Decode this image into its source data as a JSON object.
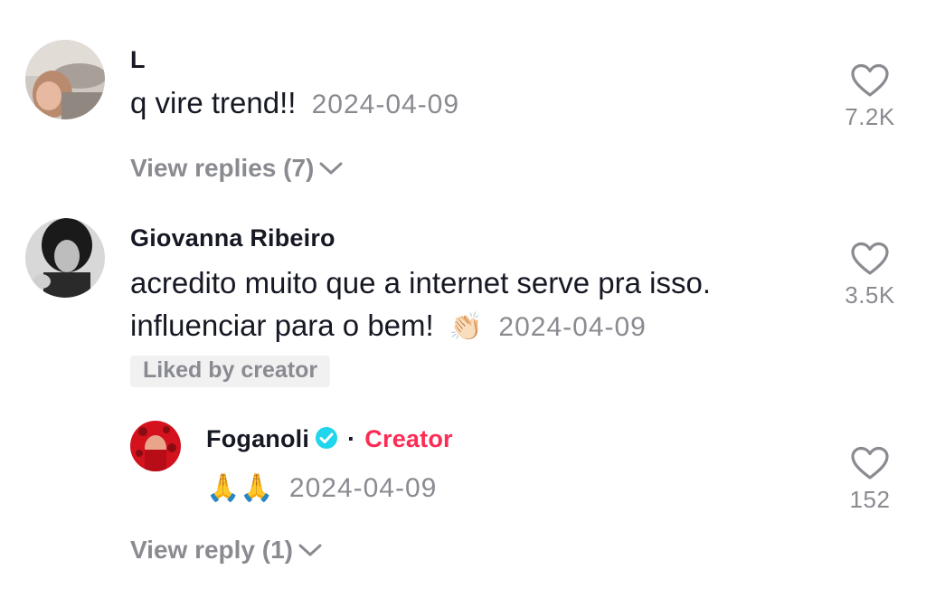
{
  "comments": [
    {
      "username": "L",
      "text": "q vire trend!!",
      "date": "2024-04-09",
      "likes": "7.2K",
      "view_replies": "View replies (7)"
    },
    {
      "username": "Giovanna Ribeiro",
      "text_line1": "acredito muito que a internet serve pra isso.",
      "text_line2": "influenciar para o bem!",
      "emoji": "👏🏻",
      "date": "2024-04-09",
      "likes": "3.5K",
      "badge": "Liked by creator",
      "reply": {
        "username": "Foganoli",
        "separator": "·",
        "creator_label": "Creator",
        "text": "🙏🙏",
        "date": "2024-04-09",
        "likes": "152"
      },
      "view_replies": "View reply (1)"
    }
  ],
  "colors": {
    "accent": "#fe2c55",
    "verified": "#20d5ec",
    "muted": "#8a8b91",
    "text": "#161823",
    "badge_bg": "#f1f1f2"
  },
  "icons": [
    "heart-outline-icon",
    "chevron-down-icon",
    "verified-badge-icon"
  ]
}
